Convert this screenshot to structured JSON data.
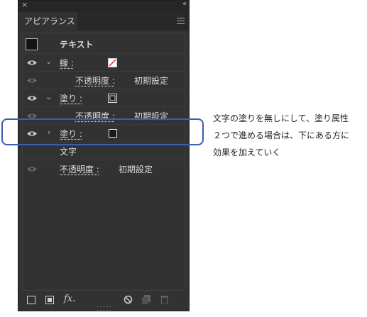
{
  "panel": {
    "tab_label": "アピアランス",
    "close_glyph": "×",
    "collapse_glyph": "‹‹",
    "header_label": "テキスト",
    "rows": [
      {
        "label": "線 :"
      },
      {
        "label": "不透明度 :",
        "value": "初期設定"
      },
      {
        "label": "塗り :"
      },
      {
        "label": "不透明度 :",
        "value": "初期設定"
      },
      {
        "label": "塗り :"
      },
      {
        "label": "文字"
      },
      {
        "label": "不透明度 :",
        "value": "初期設定"
      }
    ],
    "fx_label": "fx."
  },
  "note": {
    "lines": [
      "文字の塗りを無しにして、塗り属性",
      "２つで進める場合は、下にある方に",
      "効果を加えていく"
    ]
  },
  "colors": {
    "panel_bg": "#323232",
    "accent_callout": "#3a5fad",
    "stroke_slash": "#e0262a"
  }
}
